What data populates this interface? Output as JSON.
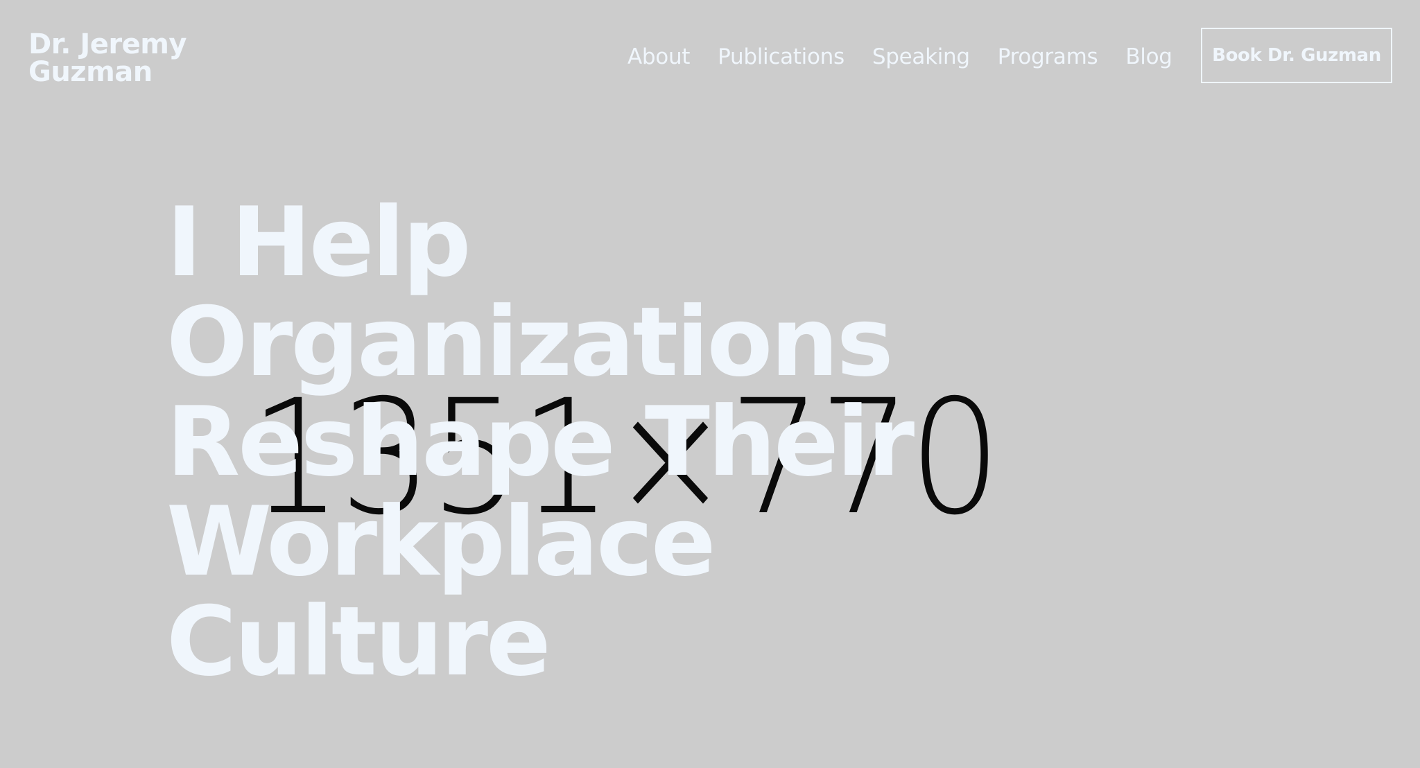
{
  "brand": {
    "line1": "Dr. Jeremy",
    "line2": "Guzman"
  },
  "nav": {
    "items": [
      "About",
      "Publications",
      "Speaking",
      "Programs",
      "Blog"
    ]
  },
  "cta": {
    "label": "Book Dr. Guzman"
  },
  "hero": {
    "lines": [
      "I Help",
      "Organizations",
      "Reshape Their",
      "Workplace",
      "Culture"
    ],
    "placeholder_text": "1351×770"
  },
  "colors": {
    "background": "#cccccc",
    "text": "#f0f6fc",
    "placeholder": "#000000"
  }
}
